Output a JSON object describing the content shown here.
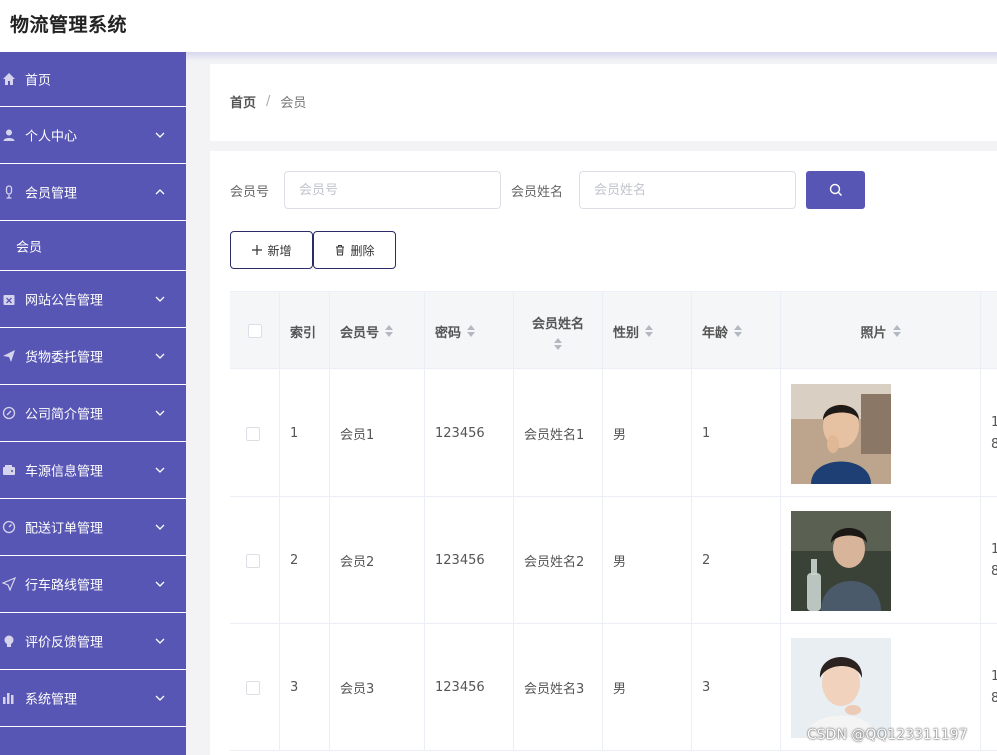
{
  "app": {
    "title": "物流管理系统"
  },
  "sidebar": {
    "items": [
      {
        "label": "首页",
        "icon": "home-icon"
      },
      {
        "label": "个人中心",
        "icon": "user-icon",
        "chevron": "down"
      },
      {
        "label": "会员管理",
        "icon": "mic-icon",
        "chevron": "up"
      },
      {
        "label": "网站公告管理",
        "icon": "briefcase-icon",
        "chevron": "down"
      },
      {
        "label": "货物委托管理",
        "icon": "send-icon",
        "chevron": "down"
      },
      {
        "label": "公司简介管理",
        "icon": "compass-icon",
        "chevron": "down"
      },
      {
        "label": "车源信息管理",
        "icon": "wallet-icon",
        "chevron": "down"
      },
      {
        "label": "配送订单管理",
        "icon": "gauge-icon",
        "chevron": "down"
      },
      {
        "label": "行车路线管理",
        "icon": "navigation-icon",
        "chevron": "down"
      },
      {
        "label": "评价反馈管理",
        "icon": "bulb-icon",
        "chevron": "down"
      },
      {
        "label": "系统管理",
        "icon": "bar-chart-icon",
        "chevron": "down"
      }
    ],
    "subitem": {
      "label": "会员"
    }
  },
  "breadcrumb": {
    "home": "首页",
    "separator": "/",
    "current": "会员"
  },
  "search": {
    "member_no_label": "会员号",
    "member_no_placeholder": "会员号",
    "member_name_label": "会员姓名",
    "member_name_placeholder": "会员姓名"
  },
  "actions": {
    "add_label": "新增",
    "delete_label": "删除"
  },
  "table": {
    "headers": {
      "index": "索引",
      "member_no": "会员号",
      "password": "密码",
      "member_name": "会员姓名",
      "gender": "性别",
      "age": "年龄",
      "photo": "照片"
    },
    "rows": [
      {
        "index": "1",
        "member_no": "会员1",
        "password": "123456",
        "member_name": "会员姓名1",
        "gender": "男",
        "age": "1",
        "extra_1": "1",
        "extra_2": "8"
      },
      {
        "index": "2",
        "member_no": "会员2",
        "password": "123456",
        "member_name": "会员姓名2",
        "gender": "男",
        "age": "2",
        "extra_1": "1",
        "extra_2": "8"
      },
      {
        "index": "3",
        "member_no": "会员3",
        "password": "123456",
        "member_name": "会员姓名3",
        "gender": "男",
        "age": "3",
        "extra_1": "1",
        "extra_2": "8"
      }
    ]
  },
  "watermark": "CSDN @QQ123311197",
  "colors": {
    "sidebar": "#5856b4",
    "accent": "#5856b4",
    "button_border": "#2d2c69"
  }
}
